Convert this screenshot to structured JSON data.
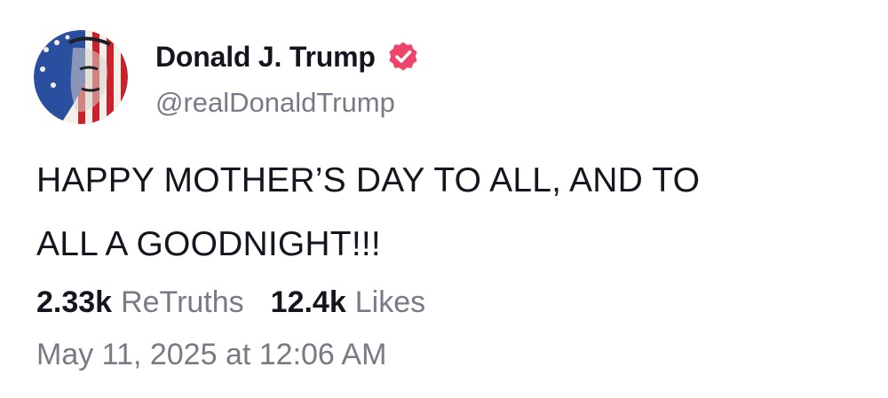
{
  "post": {
    "author": {
      "display_name": "Donald J. Trump",
      "handle": "@realDonaldTrump",
      "verified": true,
      "verified_icon": "verified-badge-icon",
      "verified_color": "#f0456a"
    },
    "text_lines": [
      "HAPPY MOTHER’S DAY TO ALL, AND TO",
      "ALL A GOODNIGHT!!!"
    ],
    "stats": {
      "retruths_count": "2.33k",
      "retruths_label": "ReTruths",
      "likes_count": "12.4k",
      "likes_label": "Likes"
    },
    "timestamp": "May 11, 2025 at 12:06 AM"
  },
  "colors": {
    "text_primary": "#16151f",
    "text_secondary": "#7a7985",
    "background": "#ffffff"
  }
}
